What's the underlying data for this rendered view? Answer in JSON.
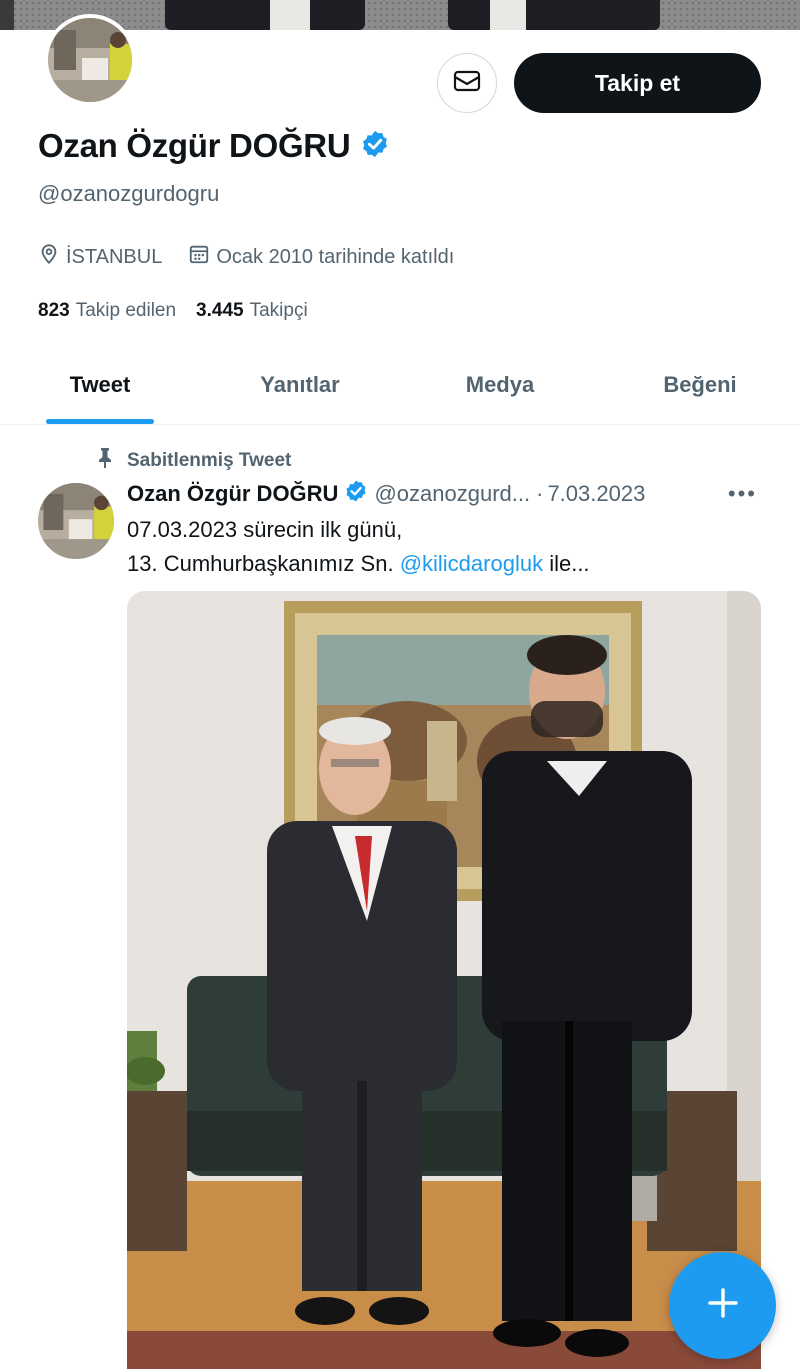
{
  "profile": {
    "name": "Ozan Özgür DOĞRU",
    "handle": "@ozanozgurdogru",
    "location": "İSTANBUL",
    "joined": "Ocak 2010 tarihinde katıldı",
    "following_count": "823",
    "following_label": "Takip edilen",
    "followers_count": "3.445",
    "followers_label": "Takipçi",
    "verified": true
  },
  "actions": {
    "follow_label": "Takip et",
    "message_icon": "envelope-icon"
  },
  "tabs": [
    {
      "label": "Tweet",
      "active": true
    },
    {
      "label": "Yanıtlar",
      "active": false
    },
    {
      "label": "Medya",
      "active": false
    },
    {
      "label": "Beğeni",
      "active": false
    }
  ],
  "pinned_tweet": {
    "pinned_label": "Sabitlenmiş Tweet",
    "author_name": "Ozan Özgür DOĞRU",
    "author_handle": "@ozanozgurd...",
    "separator": "·",
    "date": "7.03.2023",
    "more": "•••",
    "line1": "07.03.2023 sürecin ilk günü,",
    "line2_prefix": "13. Cumhurbaşkanımız Sn. ",
    "mention": "@kilicdarogluk",
    "line2_suffix": " ile..."
  },
  "colors": {
    "accent": "#1d9bf0",
    "text": "#0f1419",
    "muted": "#536471",
    "button_dark": "#0f1419"
  },
  "compose": {
    "icon": "plus-icon"
  }
}
